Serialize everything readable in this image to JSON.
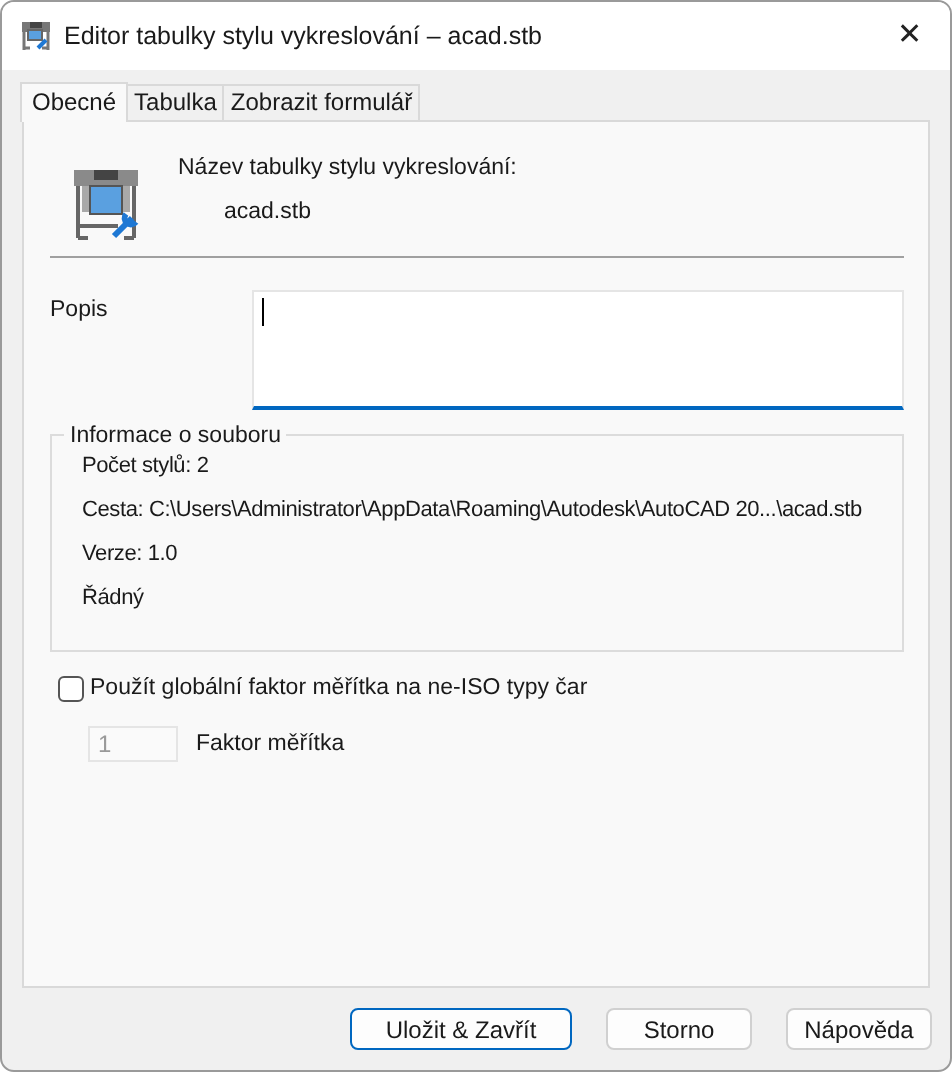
{
  "window": {
    "title": "Editor tabulky stylu vykreslování – acad.stb",
    "close": "✕"
  },
  "tabs": [
    {
      "label": "Obecné",
      "selected": true
    },
    {
      "label": "Tabulka",
      "selected": false
    },
    {
      "label": "Zobrazit formulář",
      "selected": false
    }
  ],
  "general": {
    "table_name_label": "Název tabulky stylu vykreslování:",
    "table_name": "acad.stb",
    "description_label": "Popis",
    "description_focused": true
  },
  "file_info": {
    "title": "Informace o souboru",
    "lines": [
      "Počet stylů: 2",
      "Cesta: C:\\Users\\Administrator\\AppData\\Roaming\\Autodesk\\AutoCAD 20...\\acad.stb",
      "Verze: 1.0",
      "Řádný"
    ]
  },
  "global_scale": {
    "label": "Použít globální faktor měřítka na ne-ISO typy čar",
    "checked": false,
    "factor_value": "1",
    "factor_label": "Faktor měřítka",
    "factor_disabled": true
  },
  "buttons": [
    {
      "label": "Uložit & Zavřít",
      "default": true
    },
    {
      "label": "Storno",
      "default": false
    },
    {
      "label": "Nápověda",
      "default": false
    }
  ]
}
